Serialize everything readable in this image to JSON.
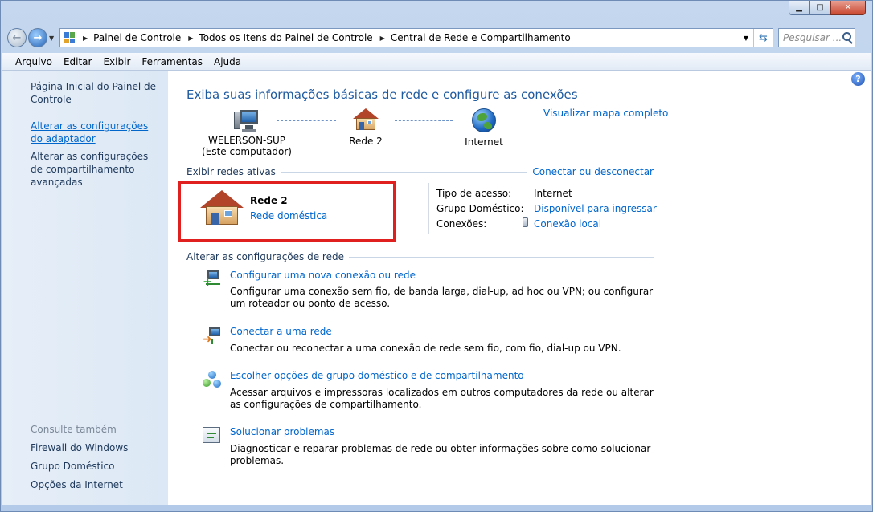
{
  "window": {
    "caption_buttons": [
      "minimize-icon",
      "maximize-icon",
      "close-icon"
    ]
  },
  "address_bar": {
    "breadcrumbs": [
      "Painel de Controle",
      "Todos os Itens do Painel de Controle",
      "Central de Rede e Compartilhamento"
    ],
    "search_placeholder": "Pesquisar ..."
  },
  "menu": [
    "Arquivo",
    "Editar",
    "Exibir",
    "Ferramentas",
    "Ajuda"
  ],
  "sidebar": {
    "links": [
      "Página Inicial do Painel de Controle",
      "Alterar as configurações do adaptador",
      "Alterar as configurações de compartilhamento avançadas"
    ],
    "see_also_label": "Consulte também",
    "see_also": [
      "Firewall do Windows",
      "Grupo Doméstico",
      "Opções da Internet"
    ]
  },
  "main": {
    "heading": "Exiba suas informações básicas de rede e configure as conexões",
    "map_link": "Visualizar mapa completo",
    "nodes": [
      {
        "name": "WELERSON-SUP",
        "sub": "(Este computador)"
      },
      {
        "name": "Rede  2",
        "sub": ""
      },
      {
        "name": "Internet",
        "sub": ""
      }
    ],
    "active_networks_label": "Exibir redes ativas",
    "connect_link": "Conectar ou desconectar",
    "active_network": {
      "name": "Rede  2",
      "type": "Rede doméstica",
      "access_type_label": "Tipo de acesso:",
      "access_type": "Internet",
      "homegroup_label": "Grupo Doméstico:",
      "homegroup": "Disponível para ingressar",
      "connections_label": "Conexões:",
      "connection": "Conexão local"
    },
    "change_settings_label": "Alterar as configurações de rede",
    "tasks": [
      {
        "title": "Configurar uma nova conexão ou rede",
        "desc": "Configurar uma conexão sem fio, de banda larga, dial-up, ad hoc ou VPN; ou configurar um roteador ou ponto de acesso."
      },
      {
        "title": "Conectar a uma rede",
        "desc": "Conectar ou reconectar a uma conexão de rede sem fio, com fio, dial-up ou VPN."
      },
      {
        "title": "Escolher opções de grupo doméstico e de compartilhamento",
        "desc": "Acessar arquivos e impressoras localizados em outros computadores da rede ou alterar as configurações de compartilhamento."
      },
      {
        "title": "Solucionar problemas",
        "desc": "Diagnosticar e reparar problemas de rede ou obter informações sobre como solucionar problemas."
      }
    ]
  },
  "colors": {
    "link": "#0066cc",
    "heading": "#1e5aa0",
    "highlight_box": "#e0201f"
  }
}
